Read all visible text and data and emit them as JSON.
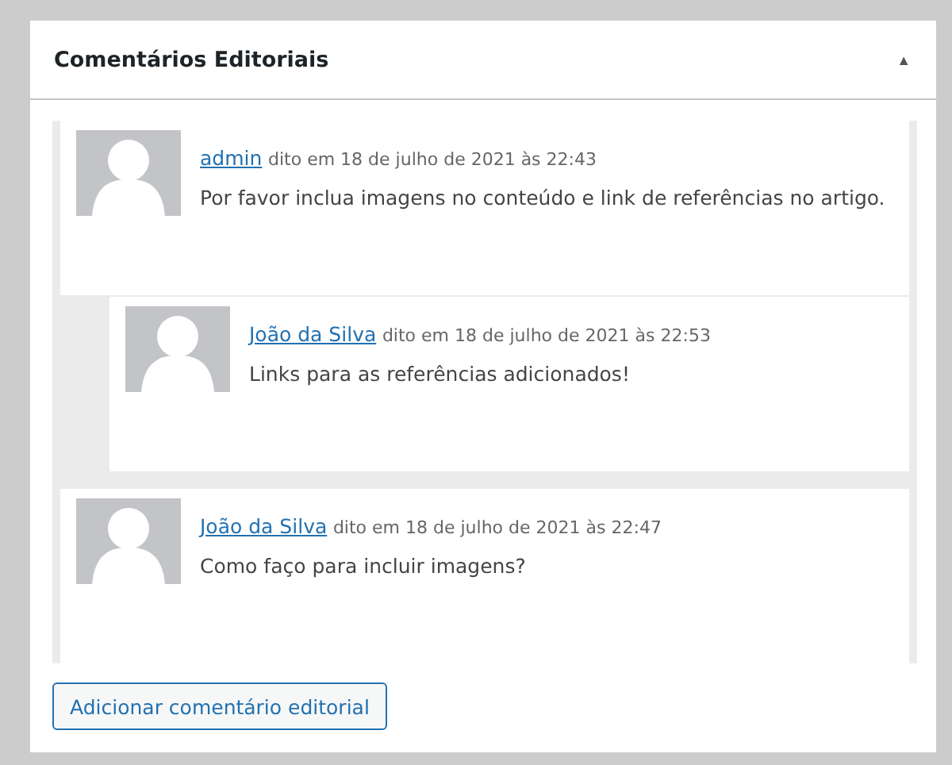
{
  "panel": {
    "title": "Comentários Editoriais",
    "toggle": "▲",
    "expanded": true
  },
  "comments": [
    {
      "author": "admin",
      "meta": "dito em 18 de julho de 2021 às 22:43",
      "text": "Por favor inclua imagens no conteúdo e link de referências no artigo.",
      "children": [
        {
          "author": "João da Silva",
          "meta": "dito em 18 de julho de 2021 às 22:53",
          "text": "Links para as referências adicionados!"
        }
      ]
    },
    {
      "author": "João da Silva",
      "meta": "dito em 18 de julho de 2021 às 22:47",
      "text": "Como faço para incluir imagens?"
    }
  ],
  "button": "Adicionar comentário editorial"
}
